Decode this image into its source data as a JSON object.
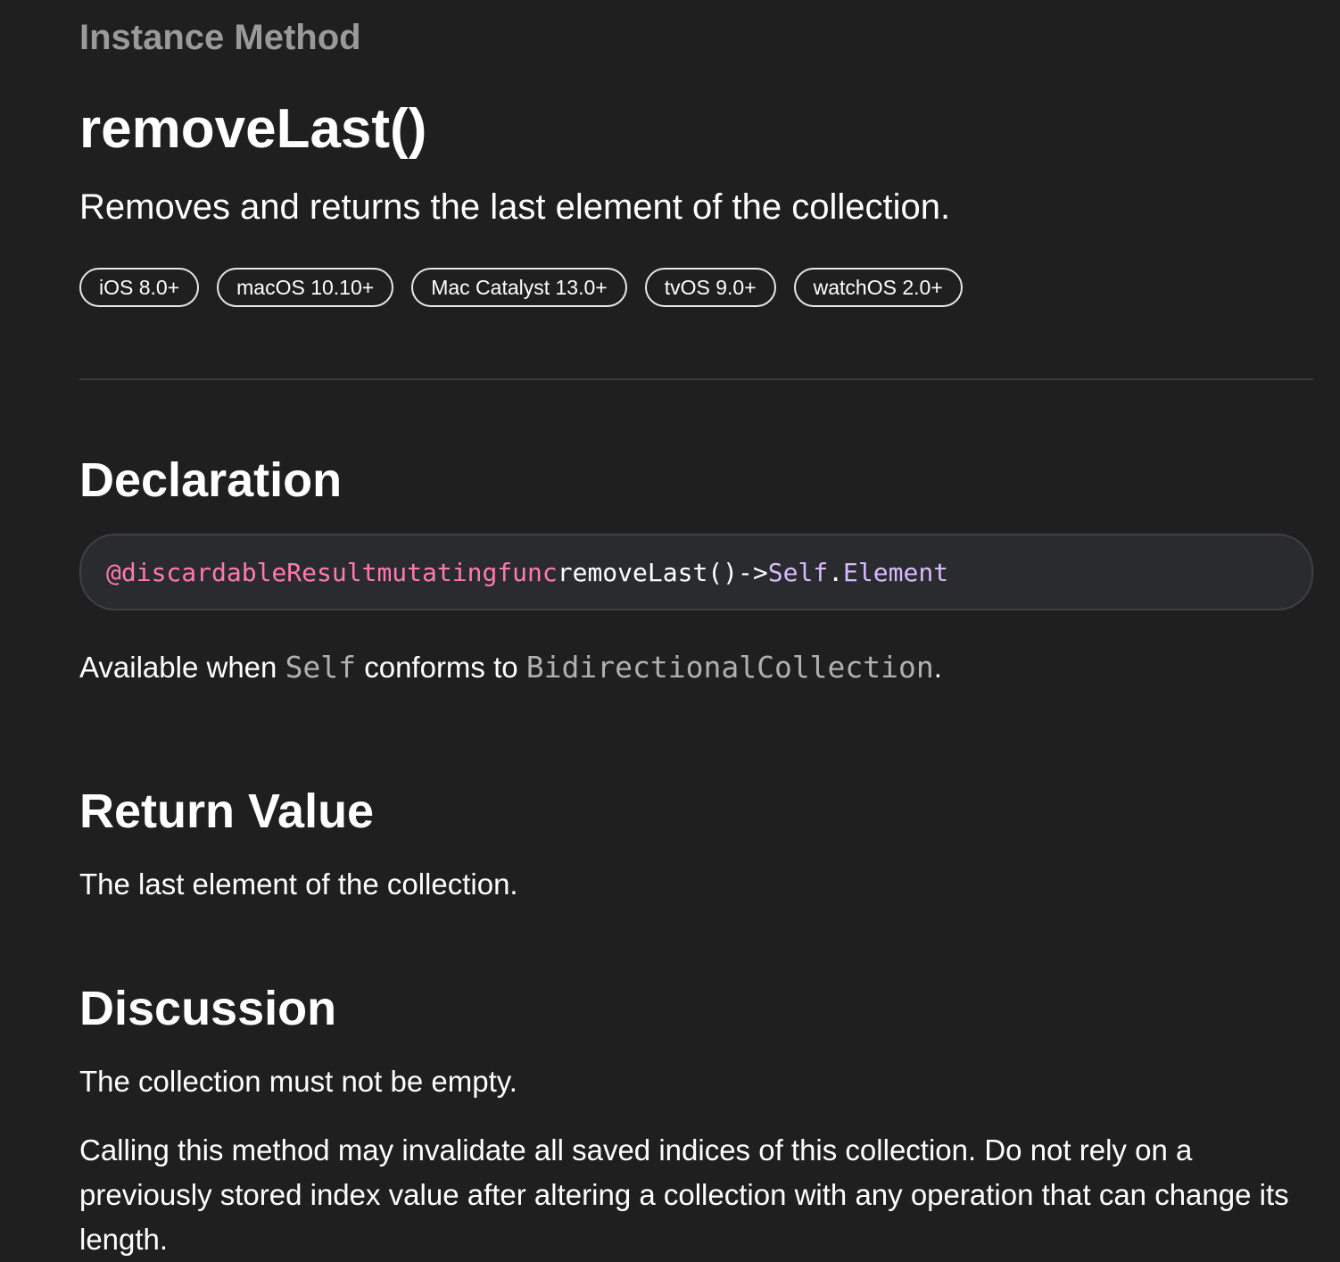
{
  "header": {
    "eyebrow": "Instance Method",
    "title": "removeLast()",
    "abstract": "Removes and returns the last element of the collection."
  },
  "platforms": [
    {
      "label": "iOS 8.0+"
    },
    {
      "label": "macOS 10.10+"
    },
    {
      "label": "Mac Catalyst 13.0+"
    },
    {
      "label": "tvOS 9.0+"
    },
    {
      "label": "watchOS 2.0+"
    }
  ],
  "declaration": {
    "heading": "Declaration",
    "code": {
      "attribute": "@discardableResult",
      "modifier": "mutating",
      "keyword": "func",
      "name": "removeLast()",
      "arrow": "->",
      "return_type_base": "Self",
      "dot": ".",
      "return_type_member": "Element"
    },
    "availability": {
      "prefix": "Available when",
      "type": "Self",
      "middle": "conforms to",
      "protocol": "BidirectionalCollection",
      "suffix": "."
    }
  },
  "return_value": {
    "heading": "Return Value",
    "text": "The last element of the collection."
  },
  "discussion": {
    "heading": "Discussion",
    "paragraphs": [
      "The collection must not be empty.",
      "Calling this method may invalidate all saved indices of this collection. Do not rely on a previously stored index value after altering a collection with any operation that can change its length."
    ]
  },
  "colors": {
    "background": "#1f1f1f",
    "keyword": "#ff7ab2",
    "type": "#dabaff",
    "eyebrow": "#9a9a9a"
  }
}
